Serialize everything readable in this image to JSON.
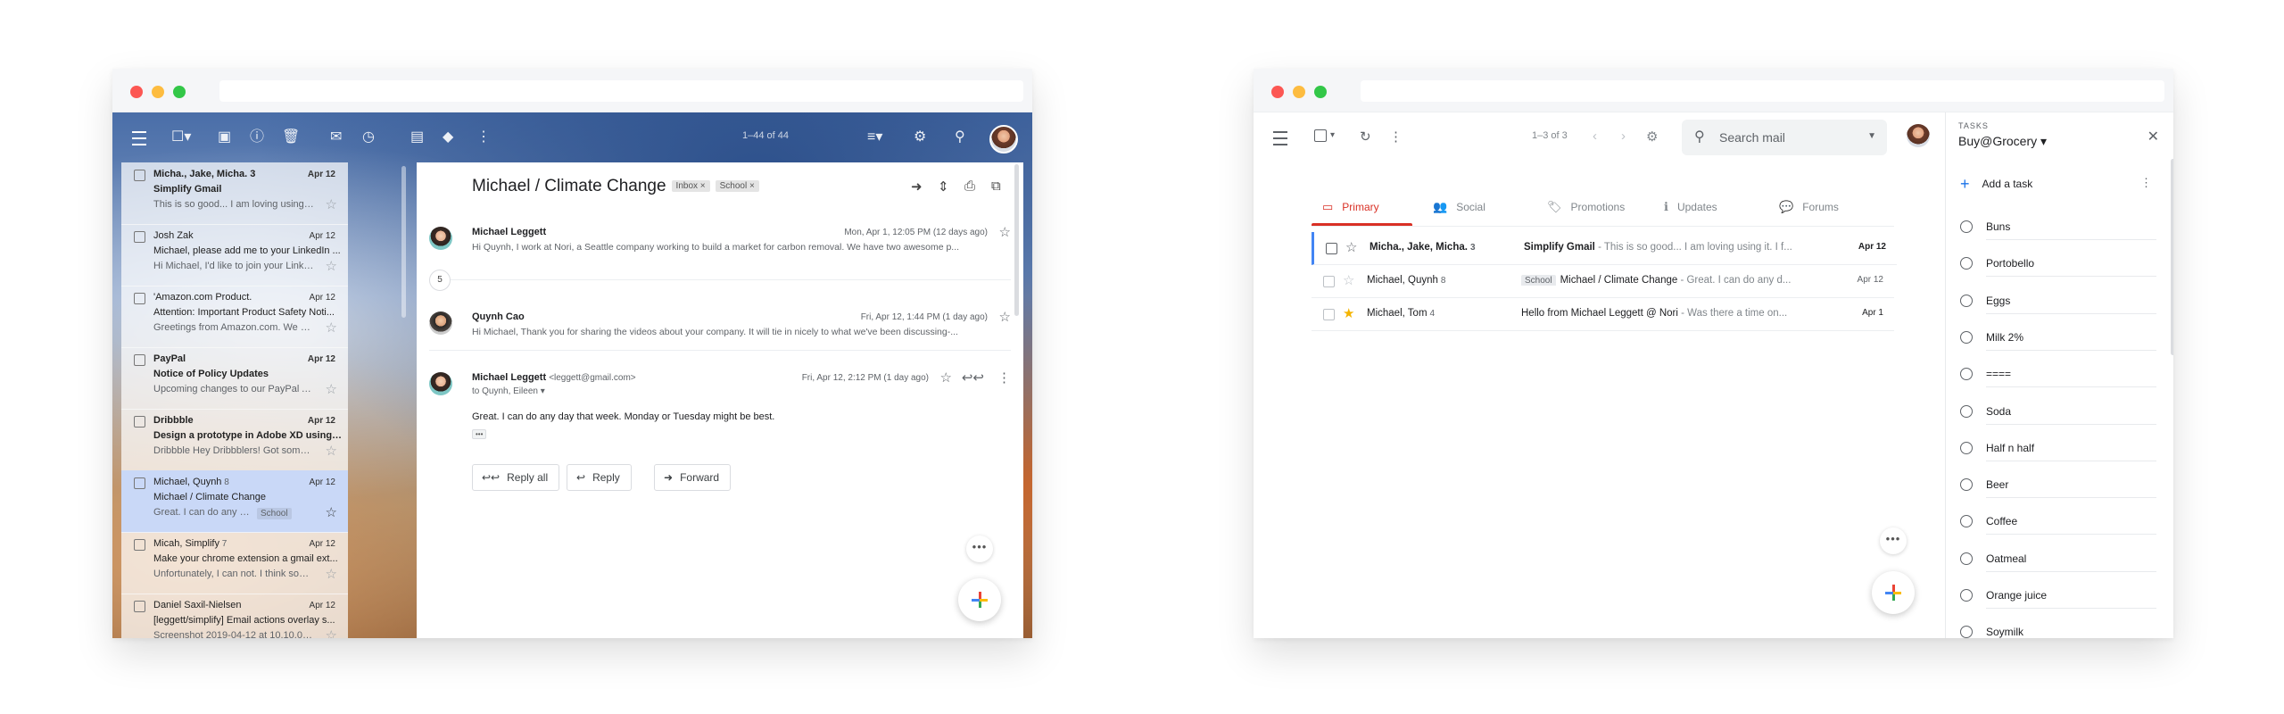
{
  "left_window": {
    "toolbar": {
      "page_count": "1–44 of 44"
    },
    "messages": [
      {
        "from_html_parts": [
          "Micha., ",
          "Jake, Micha.",
          " 3"
        ],
        "date": "Apr 12",
        "subject": "Simplify Gmail",
        "snippet": "This is so good... I am loving using it. I fe...",
        "bold": true
      },
      {
        "from_html_parts": [
          "Josh Zak",
          "",
          ""
        ],
        "date": "Apr 12",
        "subject": "Michael, please add me to your LinkedIn ...",
        "snippet": "Hi Michael, I'd like to join your LinkedIn n...",
        "bold": false
      },
      {
        "from_html_parts": [
          "'Amazon.com Product.",
          "",
          ""
        ],
        "date": "Apr 12",
        "subject": "Attention: Important Product Safety Noti...",
        "snippet": "Greetings from Amazon.com. We have le...",
        "bold": false
      },
      {
        "from_html_parts": [
          "PayPal",
          "",
          ""
        ],
        "date": "Apr 12",
        "subject": "Notice of Policy Updates",
        "snippet": "Upcoming changes to our PayPal Agree...",
        "bold": true
      },
      {
        "from_html_parts": [
          "Dribbble",
          "",
          ""
        ],
        "date": "Apr 12",
        "subject": "Design a prototype in Adobe XD using th...",
        "snippet": "Dribbble Hey Dribbblers! Got some down...",
        "bold": true
      },
      {
        "from_html_parts": [
          "Michael, Quynh",
          "",
          " 8"
        ],
        "date": "Apr 12",
        "subject": "Michael / Climate Change",
        "snippet": "Great. I can do any day that we...",
        "bold": false,
        "selected": true,
        "tag": "School"
      },
      {
        "from_html_parts": [
          "Micah, Simplify",
          "",
          " 7"
        ],
        "date": "Apr 12",
        "subject": "Make your chrome extension a gmail ext...",
        "snippet": "Unfortunately, I can not. I think some des...",
        "bold": false
      },
      {
        "from_html_parts": [
          "Daniel Saxil-Nielsen",
          "",
          ""
        ],
        "date": "Apr 12",
        "subject": "[leggett/simplify] Email actions overlay s...",
        "snippet": "Screenshot 2019-04-12 at 10.10.05 I hav...",
        "bold": false
      }
    ],
    "reader": {
      "title": "Michael / Climate Change",
      "labels": [
        "Inbox ×",
        "School ×"
      ],
      "collapsed_count": "5",
      "thread": [
        {
          "from": "Michael Leggett",
          "addr": "",
          "date": "Mon, Apr 1, 12:05 PM (12 days ago)",
          "body": "Hi Quynh, I work at Nori, a Seattle company working to build a market for carbon removal. We have two awesome p..."
        },
        {
          "from": "Quynh Cao",
          "addr": "",
          "date": "Fri, Apr 12, 1:44 PM (1 day ago)",
          "body": "Hi Michael, Thank you for sharing the videos about your company. It will tie in nicely to what we've been discussing-..."
        },
        {
          "from": "Michael Leggett",
          "addr": "<leggett@gmail.com>",
          "date": "Fri, Apr 12, 2:12 PM (1 day ago)",
          "to": "to Quynh, Eileen ▾",
          "body": "Great. I can do any day that week. Monday or Tuesday might be best."
        }
      ],
      "buttons": {
        "reply_all": "Reply all",
        "reply": "Reply",
        "forward": "Forward"
      },
      "more_dots": "•••"
    }
  },
  "right_window": {
    "toolbar": {
      "count": "1–3 of 3",
      "search_placeholder": "Search mail"
    },
    "tabs": [
      {
        "label": "Primary",
        "icon": "▭"
      },
      {
        "label": "Social",
        "icon": "👥"
      },
      {
        "label": "Promotions",
        "icon": "🏷"
      },
      {
        "label": "Updates",
        "icon": "ℹ"
      },
      {
        "label": "Forums",
        "icon": "💬"
      }
    ],
    "rows": [
      {
        "from": "Micha., Jake, Micha.",
        "count": "3",
        "subject": "Simplify Gmail",
        "snippet": " - This is so good... I am loving using it. I f...",
        "date": "Apr 12",
        "bold": true,
        "starred": false,
        "tag": ""
      },
      {
        "from": "Michael, Quynh",
        "count": "8",
        "subject": "Michael / Climate Change",
        "snippet": " - Great. I can do any d...",
        "date": "Apr 12",
        "bold": false,
        "starred": false,
        "tag": "School"
      },
      {
        "from": "Michael, Tom",
        "count": "4",
        "subject": "Hello from Michael Leggett @ Nori",
        "snippet": " - Was there a time on...",
        "date": "Apr 1",
        "bold": false,
        "starred": true,
        "tag": ""
      }
    ],
    "more_dots": "•••",
    "tasks": {
      "label": "TASKS",
      "list_name": "Buy@Grocery ▾",
      "add_label": "Add a task",
      "items": [
        "Buns",
        "Portobello",
        "Eggs",
        "Milk 2%",
        "====",
        "Soda",
        "Half n half",
        "Beer",
        "Coffee",
        "Oatmeal",
        "Orange juice",
        "Soymilk"
      ]
    }
  },
  "colors": {
    "accent_red": "#d93025",
    "accent_blue": "#4285f4",
    "selected_row": "#c9d8f7",
    "star_gold": "#f4b400"
  }
}
